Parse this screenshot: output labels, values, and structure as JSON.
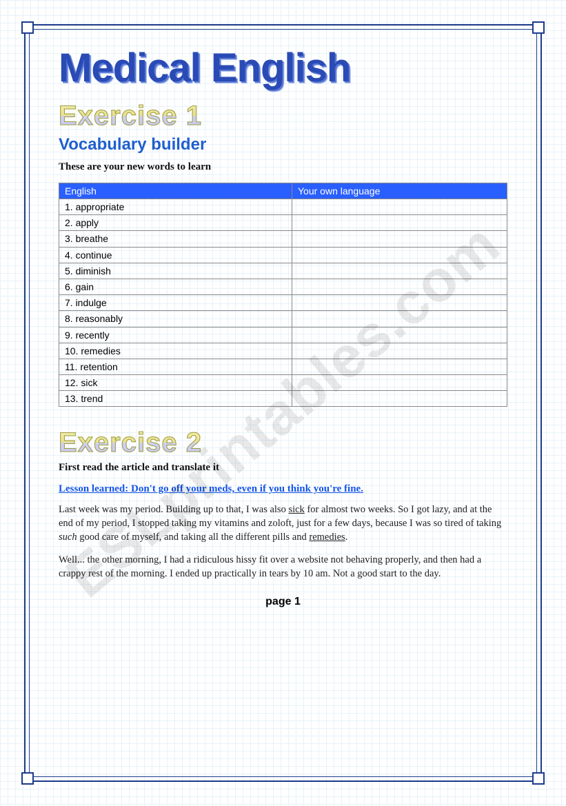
{
  "watermark": "ESLprintables.com",
  "title": "Medical English",
  "exercise1": {
    "heading": "Exercise 1",
    "subheading": "Vocabulary builder",
    "instruction": "These are your new words to learn",
    "table": {
      "col1": "English",
      "col2": "Your own language",
      "words": [
        "1. appropriate",
        "2. apply",
        "3. breathe",
        "4. continue",
        "5. diminish",
        "6. gain",
        "7. indulge",
        "8. reasonably",
        "9. recently",
        "10. remedies",
        "11. retention",
        "12. sick",
        "13. trend"
      ]
    }
  },
  "exercise2": {
    "heading": "Exercise 2",
    "instruction": "First read the article and translate it",
    "link": "Lesson learned: Don't go off your meds, even if you think you're fine.",
    "para1_a": "Last week was my period. Building up to that, I was also ",
    "para1_sick": "sick",
    "para1_b": " for almost two weeks. So I got lazy, and at the end of my period, I stopped taking my vitamins and zoloft, just for a few days, because I was so tired of taking ",
    "para1_such": "such",
    "para1_c": " good care of myself, and taking all the different pills and ",
    "para1_remedies": "remedies",
    "para1_d": ".",
    "para2": "Well... the other morning, I had a ridiculous hissy fit over a website not behaving properly, and then had a crappy rest of the morning. I ended up practically in tears by 10 am. Not a good start to the day."
  },
  "page_label": "page 1"
}
